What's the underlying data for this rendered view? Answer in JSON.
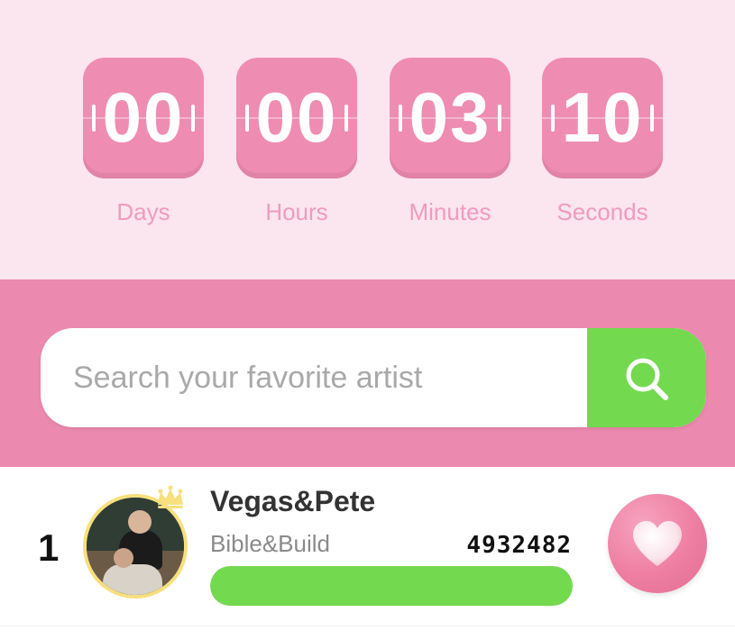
{
  "countdown": {
    "units": [
      {
        "value": "00",
        "label": "Days"
      },
      {
        "value": "00",
        "label": "Hours"
      },
      {
        "value": "03",
        "label": "Minutes"
      },
      {
        "value": "10",
        "label": "Seconds"
      }
    ]
  },
  "search": {
    "placeholder": "Search your favorite artist",
    "value": "",
    "button_icon": "search-icon"
  },
  "ranking": [
    {
      "rank": "1",
      "name": "Vegas&Pete",
      "subtitle": "Bible&Build",
      "votes": "4932482",
      "progress": 1.0,
      "badge_icon": "crown-icon",
      "vote_icon": "heart-icon"
    }
  ],
  "colors": {
    "countdown_bg": "#fbe5ef",
    "tile": "#ef8cb1",
    "tile_label": "#ef9bbd",
    "search_band": "#ec89ae",
    "accent_green": "#73d94f",
    "crown": "#f7e07d",
    "vote_button": "#ee7ea2"
  }
}
